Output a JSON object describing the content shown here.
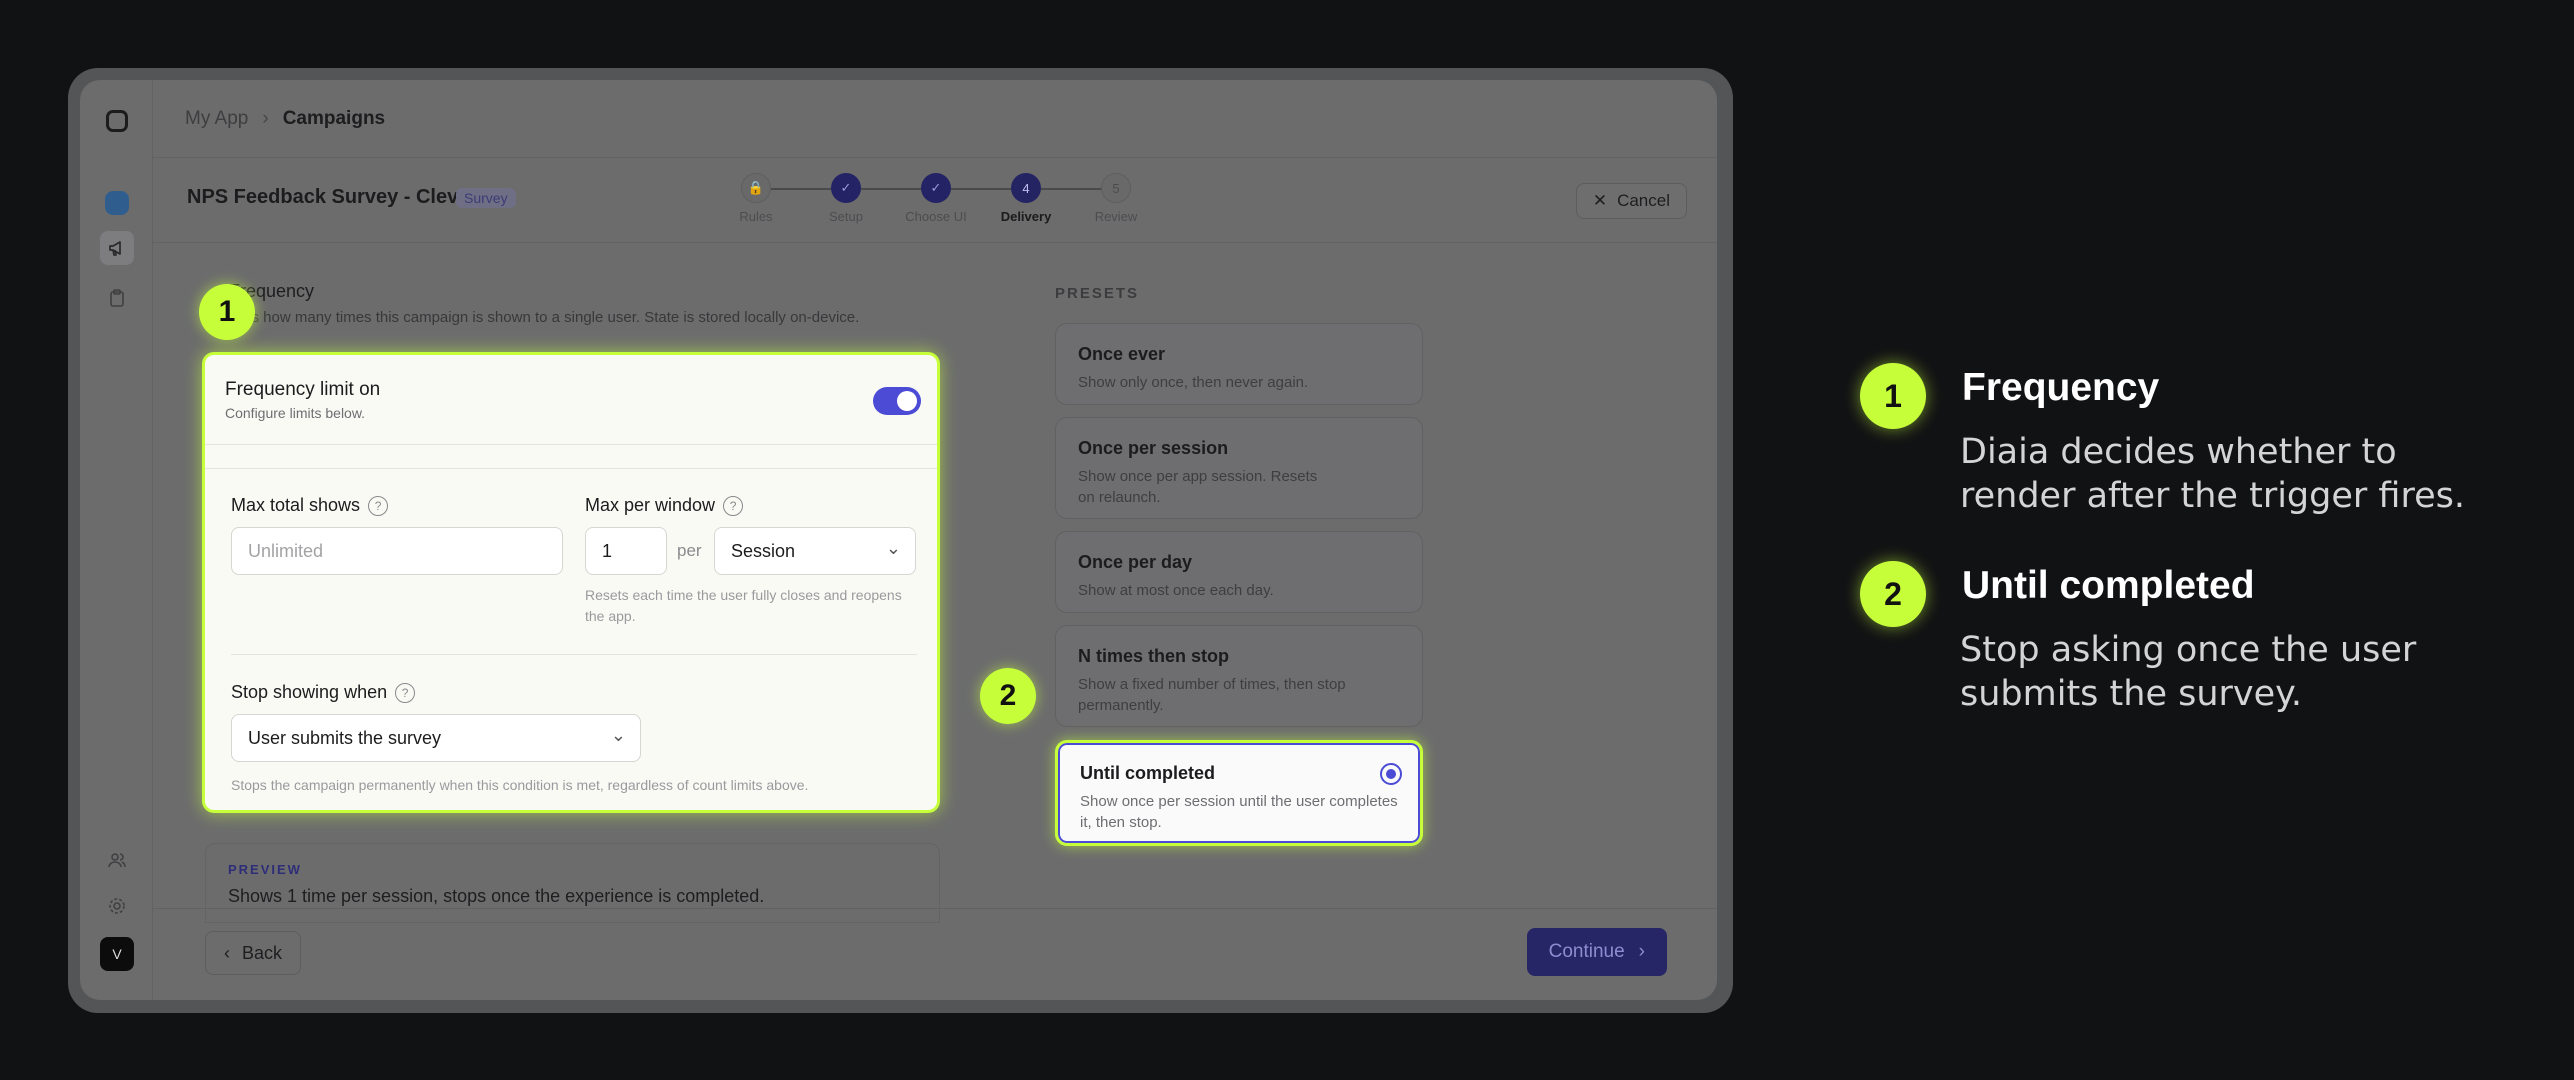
{
  "breadcrumb": {
    "app": "My App",
    "separator": "›",
    "current": "Campaigns"
  },
  "header": {
    "campaign_title": "NPS Feedback Survey - Cleve...",
    "badge": "Survey",
    "cancel_label": "Cancel"
  },
  "stepper": [
    {
      "label": "Rules",
      "symbol": "🔒",
      "state": "todo"
    },
    {
      "label": "Setup",
      "symbol": "✓",
      "state": "done"
    },
    {
      "label": "Choose UI",
      "symbol": "✓",
      "state": "done"
    },
    {
      "label": "Delivery",
      "symbol": "4",
      "state": "current"
    },
    {
      "label": "Review",
      "symbol": "5",
      "state": "todo"
    }
  ],
  "frequency": {
    "title": "Frequency",
    "description": "Sets how many times this campaign is shown to a single user. State is stored locally on-device.",
    "toggle_title": "Frequency limit on",
    "toggle_sub": "Configure limits below.",
    "toggle_on": true,
    "max_total_label": "Max total shows",
    "max_total_placeholder": "Unlimited",
    "max_window_label": "Max per window",
    "max_window_value": "1",
    "per_label": "per",
    "window_unit": "Session",
    "window_hint": "Resets each time the user fully closes and reopens the app.",
    "stop_label": "Stop showing when",
    "stop_value": "User submits the survey",
    "stop_hint": "Stops the campaign permanently when this condition is met, regardless of count limits above."
  },
  "preview": {
    "label": "PREVIEW",
    "text": "Shows 1 time per session, stops once the experience is completed."
  },
  "presets": {
    "title": "PRESETS",
    "items": [
      {
        "title": "Once ever",
        "desc": "Show only once, then never again."
      },
      {
        "title": "Once per session",
        "desc": "Show once per app session. Resets on relaunch."
      },
      {
        "title": "Once per day",
        "desc": "Show at most once each day."
      },
      {
        "title": "N times then stop",
        "desc": "Show a fixed number of times, then stop permanently."
      },
      {
        "title": "Until completed",
        "desc": "Show once per session until the user completes it, then stop.",
        "selected": true
      }
    ]
  },
  "footer": {
    "back_label": "Back",
    "continue_label": "Continue"
  },
  "markers": [
    "1",
    "2"
  ],
  "legend": [
    {
      "num": "1",
      "title": "Frequency",
      "desc": "Diaia decides whether to render after the trigger fires."
    },
    {
      "num": "2",
      "title": "Until completed",
      "desc": "Stop asking once the user submits the survey."
    }
  ],
  "sidebar": {
    "avatar_initial": "V"
  },
  "colors": {
    "accent": "#c6ff3a",
    "primary": "#4b4bd6",
    "background": "#111214"
  }
}
